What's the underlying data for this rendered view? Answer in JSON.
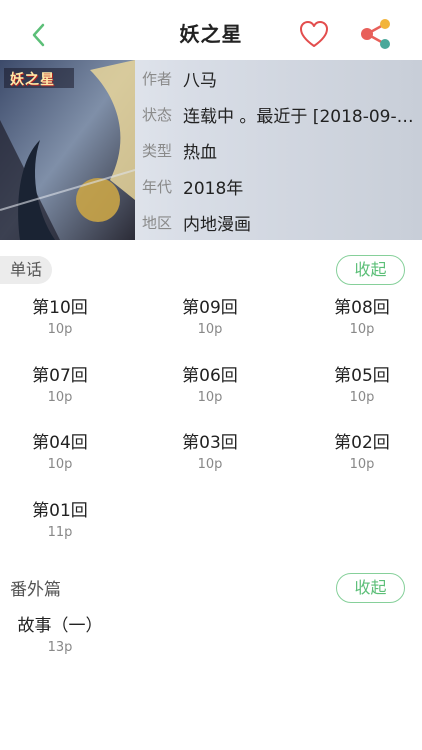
{
  "header": {
    "title": "妖之星",
    "back_icon": "chevron-left-icon",
    "favorite_icon": "heart-icon",
    "share_icon": "share-icon",
    "accent_color": "#5cbf78"
  },
  "info": {
    "cover_logo_text": "妖之星",
    "rows": [
      {
        "key": "作者",
        "value": "八马"
      },
      {
        "key": "状态",
        "value": "连载中 。最近于 [2018-09-2..."
      },
      {
        "key": "类型",
        "value": "热血"
      },
      {
        "key": "年代",
        "value": "2018年"
      },
      {
        "key": "地区",
        "value": "内地漫画"
      }
    ]
  },
  "sections": [
    {
      "name": "单话",
      "toggle_label": "收起",
      "episodes": [
        {
          "title": "第10回",
          "pages": "10p"
        },
        {
          "title": "第09回",
          "pages": "10p"
        },
        {
          "title": "第08回",
          "pages": "10p"
        },
        {
          "title": "第07回",
          "pages": "10p"
        },
        {
          "title": "第06回",
          "pages": "10p"
        },
        {
          "title": "第05回",
          "pages": "10p"
        },
        {
          "title": "第04回",
          "pages": "10p"
        },
        {
          "title": "第03回",
          "pages": "10p"
        },
        {
          "title": "第02回",
          "pages": "10p"
        },
        {
          "title": "第01回",
          "pages": "11p"
        }
      ]
    },
    {
      "name": "番外篇",
      "toggle_label": "收起",
      "episodes": [
        {
          "title": "故事（一）",
          "pages": "13p"
        }
      ]
    }
  ]
}
